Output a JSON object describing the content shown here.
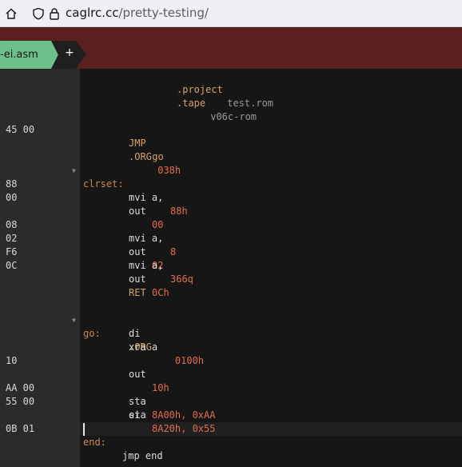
{
  "browser": {
    "url_host": "caglrc.cc",
    "url_path": "/pretty-testing/",
    "icons": [
      "home-icon",
      "shield-icon",
      "lock-icon"
    ]
  },
  "tabs": {
    "active_label": "-ei.asm",
    "add_label": "+"
  },
  "editor": {
    "lines": [
      {
        "hex": "",
        "label": "",
        "code": [
          ".project",
          " test.rom"
        ]
      },
      {
        "hex": "",
        "label": "",
        "code": [
          ".tape",
          " v06c-rom"
        ]
      },
      {
        "hex": "45 00",
        "label": "",
        "code": [
          "JMP",
          " go"
        ]
      },
      {
        "hex": "",
        "label": "",
        "code": [
          ".ORG",
          " 038h"
        ]
      },
      {
        "hex": "",
        "label": "clrset:",
        "code": []
      },
      {
        "hex": "88",
        "label": "",
        "code": [
          "mvi a, ",
          "88h"
        ]
      },
      {
        "hex": "00",
        "label": "",
        "code": [
          "out ",
          "00"
        ]
      },
      {
        "hex": "08",
        "label": "",
        "code": [
          "mvi a, ",
          "8"
        ]
      },
      {
        "hex": "02",
        "label": "",
        "code": [
          "out ",
          "02"
        ]
      },
      {
        "hex": "F6",
        "label": "",
        "code": [
          "mvi a, ",
          "366q"
        ]
      },
      {
        "hex": "0C",
        "label": "",
        "code": [
          "out ",
          "0Ch"
        ]
      },
      {
        "hex": "",
        "label": "",
        "code": [
          "RET"
        ]
      },
      {
        "hex": "",
        "label": "go:",
        "code": [
          ".ORG",
          "    0100h"
        ]
      },
      {
        "hex": "",
        "label": "",
        "code": [
          "di"
        ]
      },
      {
        "hex": "",
        "label": "",
        "code": [
          "xra a"
        ]
      },
      {
        "hex": "10",
        "label": "",
        "code": [
          "out ",
          "10h"
        ]
      },
      {
        "hex": "AA 00",
        "label": "",
        "code": [
          "sta ",
          "8A00h, 0xAA"
        ]
      },
      {
        "hex": "55 00",
        "label": "",
        "code": [
          "sta ",
          "8A20h, 0x55"
        ]
      },
      {
        "hex": "",
        "label": "",
        "code": [
          "ei"
        ]
      },
      {
        "hex": "0B 01",
        "label": "end:",
        "code": [
          "jmp end"
        ]
      }
    ]
  }
}
